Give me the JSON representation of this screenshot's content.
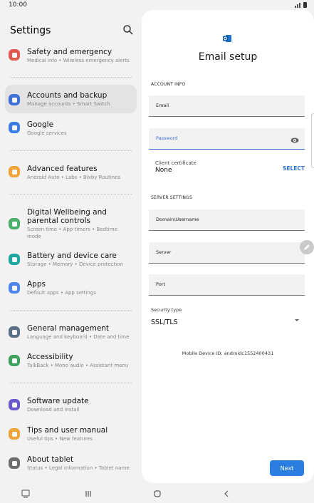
{
  "status": {
    "time": "10:00"
  },
  "settings": {
    "title": "Settings",
    "items": [
      {
        "label": "Safety and emergency",
        "sub": "Medical info • Wireless emergency alerts",
        "color": "#e05a4f",
        "icon": "alert-icon"
      },
      {
        "label": "Accounts and backup",
        "sub": "Manage accounts • Smart Switch",
        "color": "#3f70d6",
        "icon": "sync-icon"
      },
      {
        "label": "Google",
        "sub": "Google services",
        "color": "#3c7ce5",
        "icon": "google-icon"
      },
      {
        "label": "Advanced features",
        "sub": "Android Auto • Labs • Bixby Routines",
        "color": "#f1a43a",
        "icon": "gear-plus-icon"
      },
      {
        "label": "Digital Wellbeing and parental controls",
        "sub": "Screen time • App timers • Bedtime mode",
        "color": "#4caf6a",
        "icon": "wellbeing-icon"
      },
      {
        "label": "Battery and device care",
        "sub": "Storage • Memory • Device protection",
        "color": "#1ea7a0",
        "icon": "battery-icon"
      },
      {
        "label": "Apps",
        "sub": "Default apps • App settings",
        "color": "#4b86e8",
        "icon": "apps-icon"
      },
      {
        "label": "General management",
        "sub": "Language and keyboard • Date and time",
        "color": "#5a6f8a",
        "icon": "sliders-icon"
      },
      {
        "label": "Accessibility",
        "sub": "TalkBack • Mono audio • Assistant menu",
        "color": "#3da35d",
        "icon": "accessibility-icon"
      },
      {
        "label": "Software update",
        "sub": "Download and install",
        "color": "#6a5acd",
        "icon": "update-icon"
      },
      {
        "label": "Tips and user manual",
        "sub": "Useful tips • New features",
        "color": "#f0a43c",
        "icon": "bulb-icon"
      },
      {
        "label": "About tablet",
        "sub": "Status • Legal information • Tablet name",
        "color": "#6d6d6d",
        "icon": "info-icon"
      }
    ]
  },
  "email": {
    "title": "Email setup",
    "account_section": "ACCOUNT INFO",
    "email_label": "Email",
    "password_label": "Password",
    "cert_label": "Client certificate",
    "cert_value": "None",
    "select_label": "SELECT",
    "server_section": "SERVER SETTINGS",
    "domain_label": "Domain\\Username",
    "server_label": "Server",
    "port_label": "Port",
    "security_label": "Security type",
    "security_value": "SSL/TLS",
    "device_id": "Mobile Device ID: androidc1552400431",
    "next_label": "Next",
    "accent": "#2b7de0"
  }
}
